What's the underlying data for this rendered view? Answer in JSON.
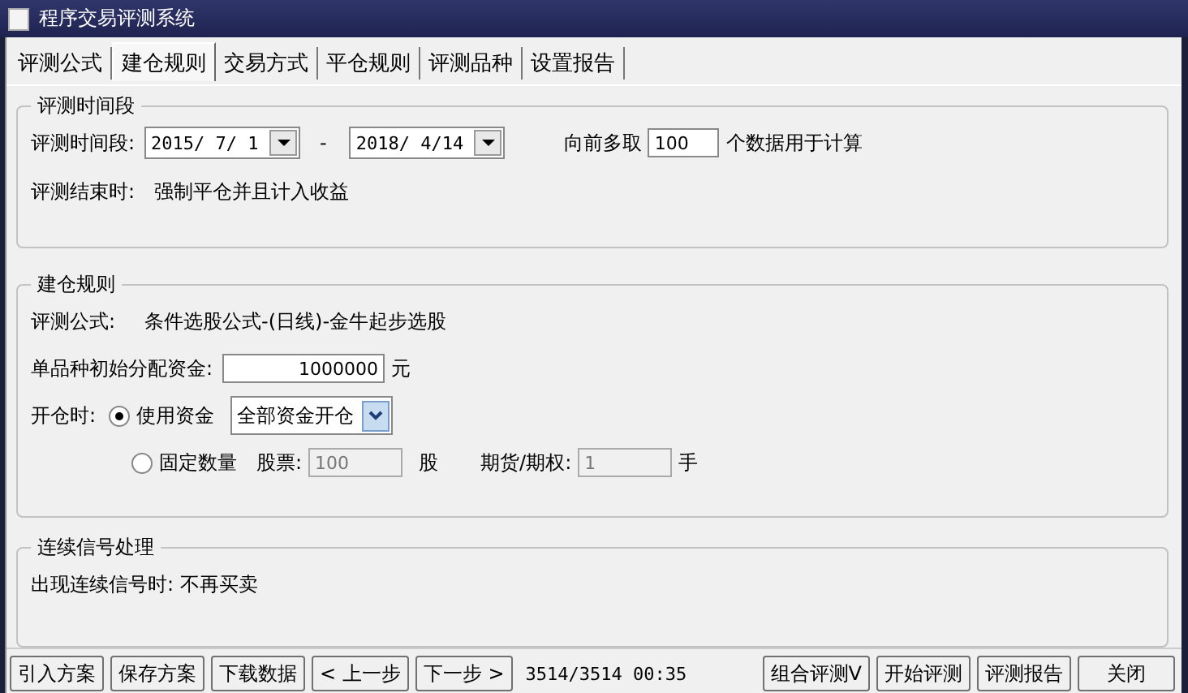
{
  "window": {
    "title": "程序交易评测系统"
  },
  "tabs": [
    {
      "label": "评测公式",
      "selected": false
    },
    {
      "label": "建仓规则",
      "selected": true
    },
    {
      "label": "交易方式",
      "selected": false
    },
    {
      "label": "平仓规则",
      "selected": false
    },
    {
      "label": "评测品种",
      "selected": false
    },
    {
      "label": "设置报告",
      "selected": false
    }
  ],
  "period_group": {
    "title": "评测时间段",
    "label": "评测时间段:",
    "start_date": "2015/ 7/ 1",
    "separator": "-",
    "end_date": "2018/ 4/14",
    "lookback_label": "向前多取",
    "lookback_value": "100",
    "lookback_suffix": "个数据用于计算",
    "end_label": "评测结束时:",
    "end_value": "强制平仓并且计入收益"
  },
  "entry_group": {
    "title": "建仓规则",
    "formula_label": "评测公式:",
    "formula_value": "条件选股公式-(日线)-金牛起步选股",
    "capital_label": "单品种初始分配资金:",
    "capital_value": "1000000",
    "capital_unit": "元",
    "open_label": "开仓时:",
    "options": [
      {
        "label": "使用资金",
        "selected": true
      },
      {
        "label": "固定数量",
        "selected": false
      }
    ],
    "fund_mode": "全部资金开仓",
    "stock_label": "股票:",
    "stock_value": "100",
    "stock_unit": "股",
    "futures_label": "期货/期权:",
    "futures_value": "1",
    "futures_unit": "手"
  },
  "signal_group": {
    "title": "连续信号处理",
    "label": "出现连续信号时:",
    "value": "不再买卖"
  },
  "toolbar_left": [
    "引入方案",
    "保存方案",
    "下载数据",
    "< 上一步",
    "下一步 >"
  ],
  "status": "3514/3514 00:35",
  "toolbar_right": [
    "组合评测V",
    "开始评测",
    "评测报告",
    "关闭"
  ]
}
